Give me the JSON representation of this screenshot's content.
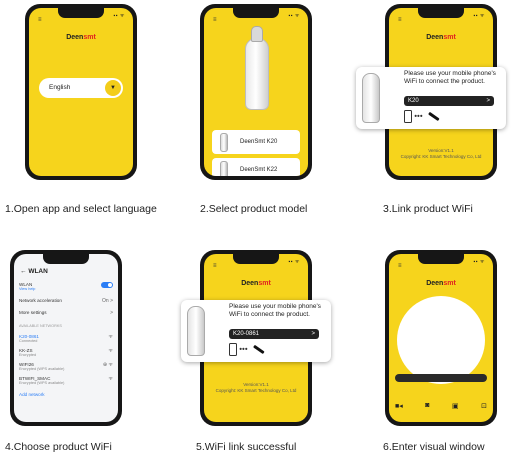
{
  "brand": {
    "name_prefix": "Deen",
    "name_suffix": "smt",
    "accent": "#f6d41c",
    "logo_red": "#e02020"
  },
  "status_bar": {
    "icons": "▪▪ ᯤ"
  },
  "steps": [
    {
      "caption": "1.Open app and select language"
    },
    {
      "caption": "2.Select product model"
    },
    {
      "caption": "3.Link product WiFi"
    },
    {
      "caption": "4.Choose product WiFi"
    },
    {
      "caption": "5.WiFi link successful"
    },
    {
      "caption": "6.Enter visual window"
    }
  ],
  "screen1": {
    "language": "English",
    "dropdown_icon": "▼"
  },
  "screen2": {
    "models": [
      "DeenSmt K20",
      "DeenSmt K22"
    ]
  },
  "screen3": {
    "prompt": "Please use your mobile phone's WiFi to connect the product.",
    "field": "K20",
    "version": "Version:V1.1",
    "copyright": "Copyright: KK Smart Technology Co, Ltd"
  },
  "screen4": {
    "title": "WLAN",
    "wlan_label": "WLAN",
    "view_help": "View help",
    "network_acceleration": "Network acceleration",
    "network_acceleration_value": "On",
    "more_settings": "More settings",
    "available_header": "AVAILABLE NETWORKS",
    "networks": [
      {
        "name": "K20-0861",
        "status": "Connected"
      },
      {
        "name": "KK-ZS",
        "status": "Encrypted"
      },
      {
        "name": "WIFI26",
        "status": "Encrypted (WPS available)"
      },
      {
        "name": "BTWIFI_SMAC",
        "status": "Encrypted (WPS available)"
      }
    ],
    "add_network": "Add network"
  },
  "screen5": {
    "prompt": "Please use your mobile phone's WiFi to connect the product.",
    "field": "K20-0861",
    "version": "Version:V1.1",
    "copyright": "Copyright: KK Smart Technology Co, Ltd"
  },
  "screen6": {
    "toolbar": [
      "video-icon",
      "camera-icon",
      "gallery-icon",
      "info-icon"
    ]
  }
}
